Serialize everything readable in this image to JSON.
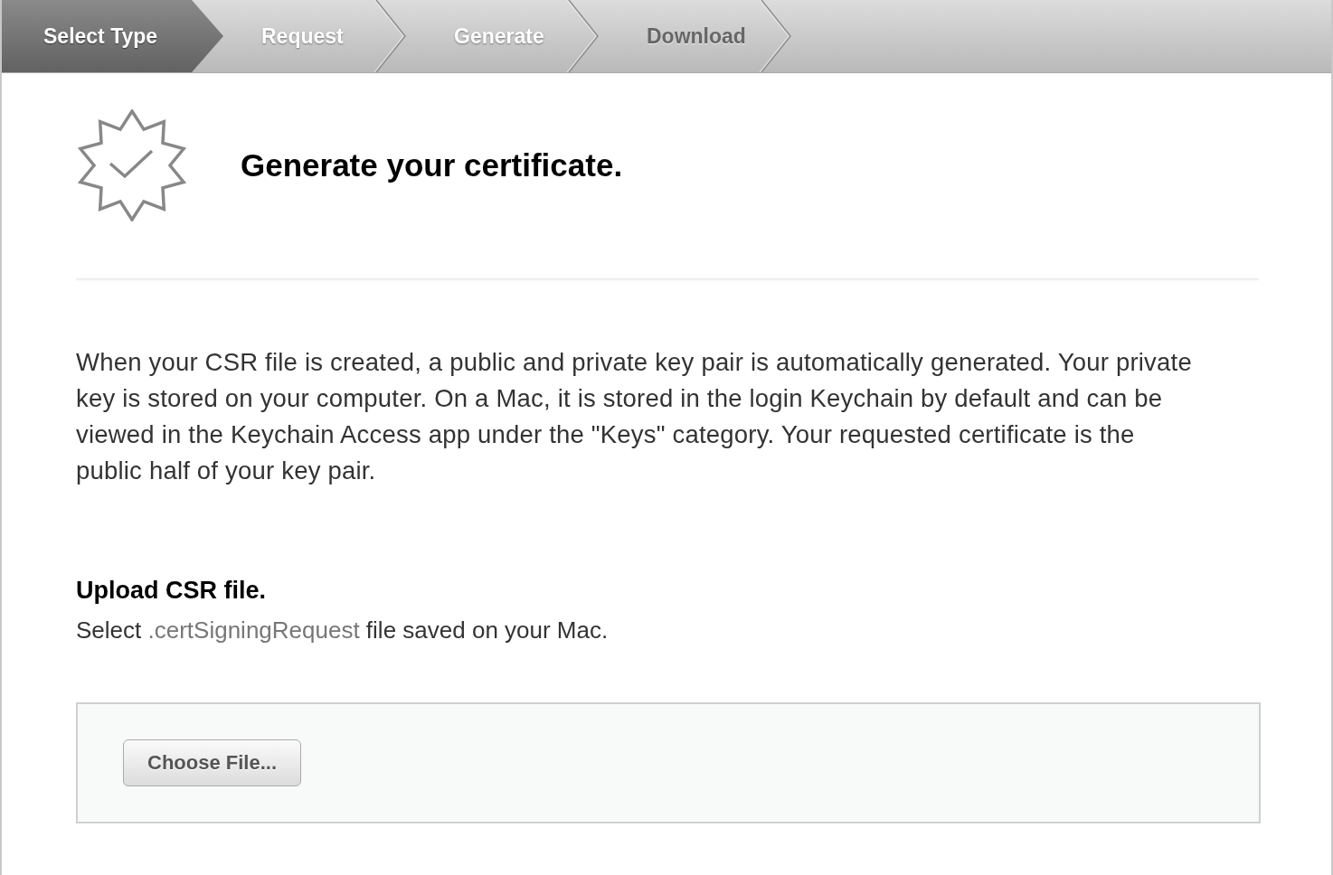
{
  "steps": [
    {
      "label": "Select Type",
      "selected": true,
      "disabled": false
    },
    {
      "label": "Request",
      "selected": false,
      "disabled": false
    },
    {
      "label": "Generate",
      "selected": false,
      "disabled": false
    },
    {
      "label": "Download",
      "selected": false,
      "disabled": true
    }
  ],
  "header": {
    "title": "Generate your certificate."
  },
  "description": "When your CSR file is created, a public and private key pair is automatically generated. Your private key is stored on your computer. On a Mac, it is stored in the login Keychain by default and can be viewed in the Keychain Access app under the \"Keys\" category. Your requested certificate is the public half of your key pair.",
  "upload": {
    "heading": "Upload CSR file.",
    "instruction": {
      "before": "Select ",
      "filename": ".certSigningRequest",
      "after": " file saved on your Mac."
    },
    "button": "Choose File..."
  }
}
